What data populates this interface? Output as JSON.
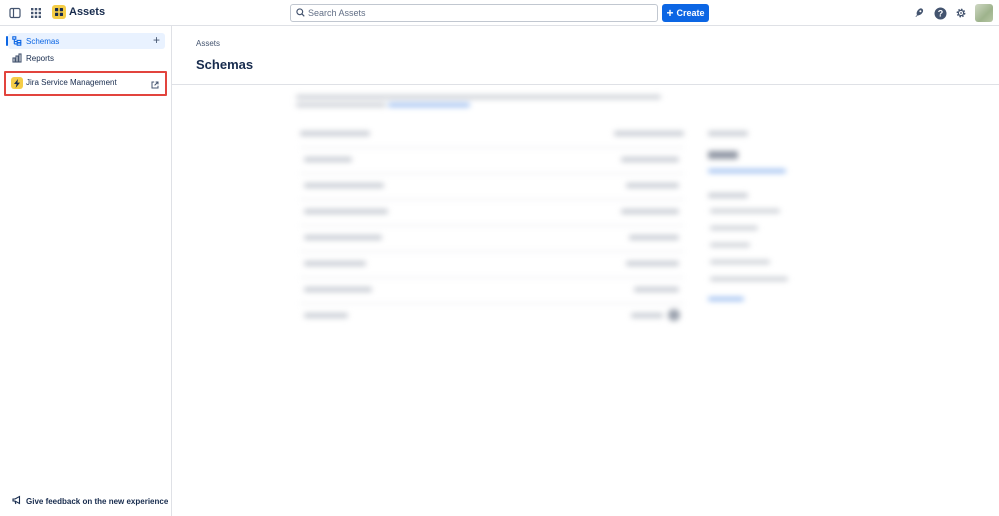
{
  "app": {
    "name": "Assets",
    "logo_icon": "assets-logo-icon",
    "accent": "#f5cd47"
  },
  "topbar": {
    "search_placeholder": "Search Assets",
    "create_label": "Create",
    "primary_color": "#0c66e4"
  },
  "sidebar": {
    "items": [
      {
        "label": "Schemas",
        "icon": "schemas-icon",
        "active": true
      },
      {
        "label": "Reports",
        "icon": "reports-icon",
        "active": false
      }
    ],
    "external_link": {
      "label": "Jira Service Management",
      "icon": "jira-service-management-icon",
      "highlight_color": "#e2443d"
    },
    "feedback_label": "Give feedback on the new experience"
  },
  "main": {
    "breadcrumb": "Assets",
    "title": "Schemas"
  }
}
